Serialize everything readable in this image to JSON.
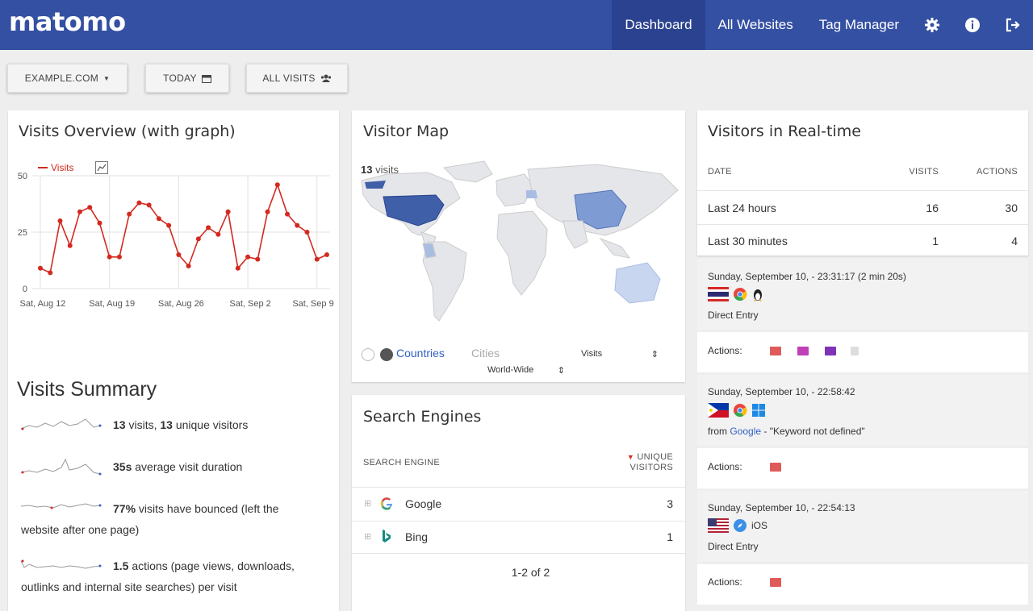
{
  "app": {
    "logo": "matomo"
  },
  "nav": [
    {
      "label": "Dashboard",
      "active": true
    },
    {
      "label": "All Websites",
      "active": false
    },
    {
      "label": "Tag Manager",
      "active": false
    }
  ],
  "nav_icons": [
    "gear-icon",
    "info-icon",
    "sign-out-icon"
  ],
  "toolbar": {
    "site_selector": "EXAMPLE.COM",
    "period_selector": "TODAY",
    "segment_selector": "ALL VISITS"
  },
  "visits_overview": {
    "title": "Visits Overview (with graph)",
    "legend_label": "Visits",
    "chart_data": {
      "type": "line",
      "series": [
        {
          "name": "Visits",
          "values": [
            9,
            7,
            30,
            19,
            34,
            36,
            29,
            14,
            14,
            33,
            38,
            37,
            31,
            28,
            15,
            10,
            22,
            27,
            24,
            34,
            9,
            14,
            13,
            34,
            46,
            33,
            28,
            25,
            13,
            15
          ]
        }
      ],
      "x_tick_labels": [
        "Sat, Aug 12",
        "Sat, Aug 19",
        "Sat, Aug 26",
        "Sat, Sep 2",
        "Sat, Sep 9"
      ],
      "y_tick_labels": [
        "50",
        "25",
        "0"
      ],
      "ylim": [
        0,
        50
      ],
      "color": "#d4291f",
      "grid": true
    }
  },
  "visits_summary": {
    "title": "Visits Summary",
    "rows": [
      {
        "b1": "13",
        "t1": " visits, ",
        "b2": "13",
        "t2": " unique visitors"
      },
      {
        "b1": "35s",
        "t1": " average visit duration",
        "b2": "",
        "t2": ""
      },
      {
        "b1": "77%",
        "t1": " visits have bounced (left the",
        "line2": "website after one page)"
      },
      {
        "b1": "1.5",
        "t1": " actions (page views, downloads,",
        "line2": "outlinks and internal site searches) per visit"
      }
    ]
  },
  "visitor_map": {
    "title": "Visitor Map",
    "visits_count": "13",
    "visits_label": " visits",
    "mode_countries": "Countries",
    "mode_cities": "Cities",
    "metric_select": "Visits",
    "region_select": "World-Wide"
  },
  "search_engines": {
    "title": "Search Engines",
    "col_engine": "SEARCH ENGINE",
    "col_visitors_1": "UNIQUE",
    "col_visitors_2": "VISITORS",
    "rows": [
      {
        "name": "Google",
        "value": "3"
      },
      {
        "name": "Bing",
        "value": "1"
      }
    ],
    "pagination": "1-2 of 2"
  },
  "realtime": {
    "title": "Visitors in Real-time",
    "col_date": "DATE",
    "col_visits": "VISITS",
    "col_actions": "ACTIONS",
    "rows": [
      {
        "label": "Last 24 hours",
        "visits": "16",
        "actions": "30"
      },
      {
        "label": "Last 30 minutes",
        "visits": "1",
        "actions": "4"
      }
    ],
    "visits": [
      {
        "date": "Sunday, September 10, - 23:31:17 (2 min 20s)",
        "referrer": "Direct Entry",
        "actions_label": "Actions:"
      },
      {
        "date": "Sunday, September 10, - 22:58:42",
        "referrer_prefix": "from ",
        "referrer_link": "Google",
        "referrer_suffix": " - \"Keyword not defined\"",
        "actions_label": "Actions:"
      },
      {
        "date": "Sunday, September 10, - 22:54:13",
        "os": "iOS",
        "referrer": "Direct Entry",
        "actions_label": "Actions:"
      }
    ]
  }
}
